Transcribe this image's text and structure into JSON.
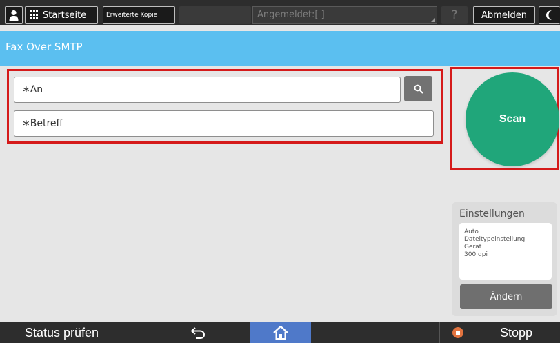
{
  "topbar": {
    "home_label": "Startseite",
    "copy_label": "Erweiterte Kopie",
    "login_placeholder": "Angemeldet:[ ]",
    "help_label": "?",
    "logout_label": "Abmelden"
  },
  "app": {
    "title": "Fax Over SMTP"
  },
  "form": {
    "to_label": "∗An",
    "to_value": "",
    "subject_label": "∗Betreff",
    "subject_value": ""
  },
  "scan": {
    "label": "Scan"
  },
  "settings": {
    "heading": "Einstellungen",
    "lines": [
      "Auto",
      "Dateitypeinstellung",
      "Gerät",
      "300 dpi"
    ],
    "change_label": "Ändern"
  },
  "bottombar": {
    "status_label": "Status prüfen",
    "stop_label": "Stopp"
  },
  "colors": {
    "title_bar": "#5bbff0",
    "scan_button": "#20a67a",
    "highlight": "#d51a1a",
    "home_nav": "#4f79c9",
    "stop_icon": "#e2733f"
  },
  "icons": [
    "user-icon",
    "grid-icon",
    "moon-icon",
    "search-icon",
    "back-icon",
    "home-icon",
    "stop-icon"
  ]
}
